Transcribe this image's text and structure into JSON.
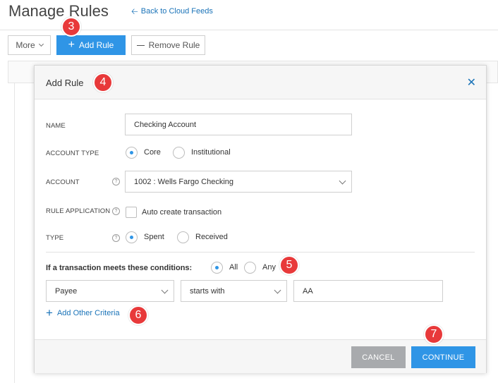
{
  "page": {
    "title": "Manage Rules",
    "back_link": "Back to Cloud Feeds"
  },
  "toolbar": {
    "more_label": "More",
    "add_rule_label": "Add Rule",
    "remove_rule_label": "Remove Rule"
  },
  "modal": {
    "title": "Add Rule",
    "fields": {
      "name_label": "NAME",
      "name_value": "Checking Account",
      "account_type_label": "ACCOUNT TYPE",
      "account_type_options": [
        "Core",
        "Institutional"
      ],
      "account_type_selected": "Core",
      "account_label": "ACCOUNT",
      "account_value": "1002 : Wells Fargo Checking",
      "rule_application_label": "RULE APPLICATION",
      "auto_create_label": "Auto create transaction",
      "type_label": "TYPE",
      "type_options": [
        "Spent",
        "Received"
      ],
      "type_selected": "Spent"
    },
    "conditions": {
      "title": "If a transaction meets these conditions:",
      "match_options": [
        "All",
        "Any"
      ],
      "match_selected": "All",
      "field_value": "Payee",
      "operator_value": "starts with",
      "criteria_value": "AA",
      "add_criteria_label": "Add Other Criteria"
    },
    "footer": {
      "cancel_label": "CANCEL",
      "continue_label": "CONTINUE"
    }
  },
  "annotations": [
    "3",
    "4",
    "5",
    "6",
    "7"
  ],
  "colors": {
    "primary": "#2f95e6",
    "link": "#1a73b8",
    "badge": "#e8393a",
    "cancel": "#a8aaad"
  }
}
